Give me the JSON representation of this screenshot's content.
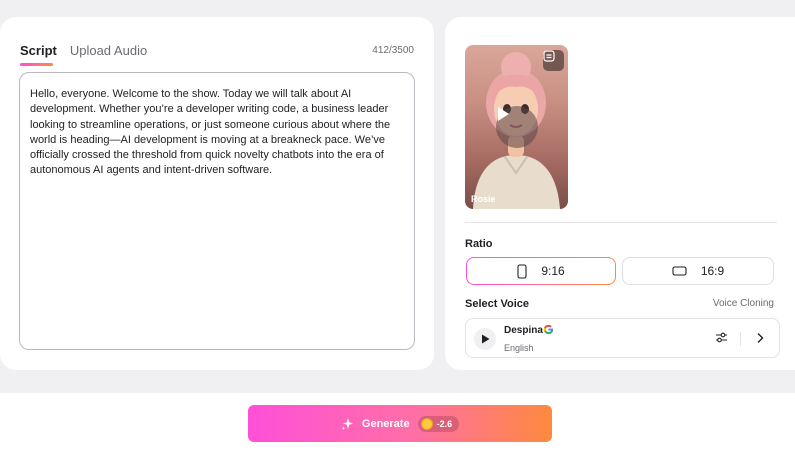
{
  "script_panel": {
    "tabs": [
      {
        "label": "Script",
        "active": true
      },
      {
        "label": "Upload Audio",
        "active": false
      }
    ],
    "char_count": "412/3500",
    "script_text": "Hello, everyone. Welcome to the show. Today we will talk about AI development. Whether you’re a developer writing code, a business leader looking to streamline operations, or just someone curious about where the world is heading—AI development is moving at a breakneck pace. We’ve officially crossed the threshold from quick novelty chatbots into the era of autonomous AI agents and intent-driven software."
  },
  "avatar": {
    "name": "Rosie",
    "icons": {
      "chip": "swap-avatar-icon",
      "play": "play-icon"
    }
  },
  "ratio": {
    "title": "Ratio",
    "options": [
      {
        "label": "9:16",
        "icon": "portrait-phone-icon",
        "selected": true
      },
      {
        "label": "16:9",
        "icon": "landscape-screen-icon",
        "selected": false
      }
    ]
  },
  "voice": {
    "title": "Select Voice",
    "cloning_link": "Voice Cloning",
    "selected": {
      "name": "Despina",
      "language": "English",
      "provider_icon": "google-icon"
    }
  },
  "generate": {
    "label": "Generate",
    "cost": "-2.6",
    "icons": {
      "sparkle": "sparkle-icon",
      "coin": "coin-icon"
    }
  },
  "colors": {
    "accent_start": "#ff4fd8",
    "accent_end": "#ff8a3d",
    "page_bg": "#f0f0f3"
  }
}
